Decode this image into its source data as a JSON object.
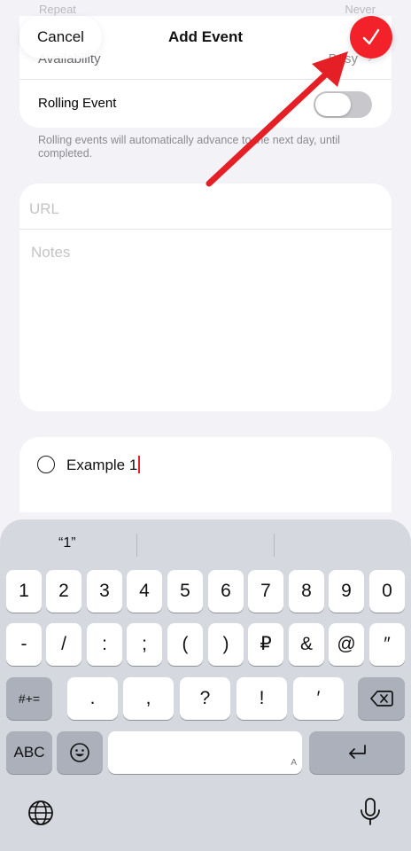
{
  "header": {
    "cancel_label": "Cancel",
    "title": "Add Event",
    "done_icon": "checkmark-icon",
    "done_color": "#f3222a"
  },
  "ghost_row": {
    "label": "Repeat",
    "value": "Never"
  },
  "availability": {
    "label": "Availability",
    "value": "Busy"
  },
  "rolling": {
    "label": "Rolling Event",
    "enabled": false,
    "footnote": "Rolling events will automatically advance to the next day, until completed."
  },
  "fields": {
    "url_placeholder": "URL",
    "notes_placeholder": "Notes"
  },
  "subtask": {
    "text": "Example 1"
  },
  "keyboard": {
    "suggestions": [
      "“1”",
      "",
      ""
    ],
    "row1": [
      "1",
      "2",
      "3",
      "4",
      "5",
      "6",
      "7",
      "8",
      "9",
      "0"
    ],
    "row2": [
      "-",
      "/",
      ":",
      ";",
      "(",
      ")",
      "₽",
      "&",
      "@",
      "″"
    ],
    "row3_left": "#+=",
    "row3_mid": [
      ".",
      ",",
      "?",
      "!",
      "′"
    ],
    "abc_label": "ABC",
    "space_hint": "A",
    "accent_color": "#e0242a"
  },
  "annotation": {
    "arrow_color": "#e41f26"
  }
}
